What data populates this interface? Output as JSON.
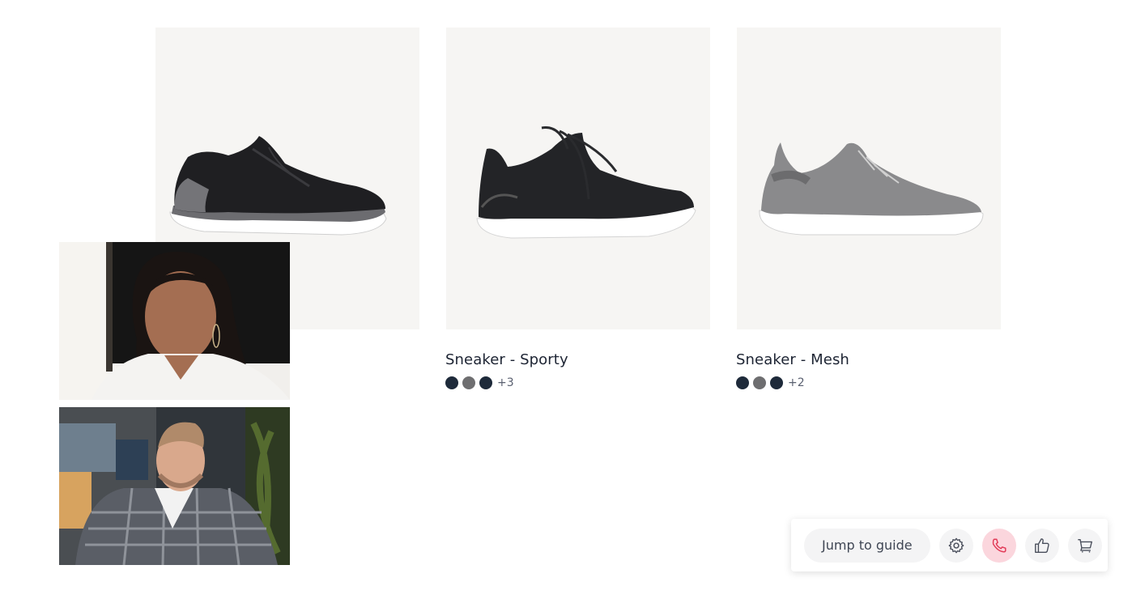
{
  "products": [
    {
      "name": "",
      "shoe_color": "#1f1f22",
      "swatch_colors": []
    },
    {
      "name": "Sneaker - Sporty",
      "shoe_color": "#232427",
      "swatch_colors": [
        "#1e2a3a",
        "#6e6e70",
        "#1e2a3a"
      ],
      "more": "+3"
    },
    {
      "name": "Sneaker - Mesh",
      "shoe_color": "#8a8a8c",
      "swatch_colors": [
        "#1e2a3a",
        "#6e6e70",
        "#1e2a3a"
      ],
      "more": "+2"
    }
  ],
  "controls": {
    "jump_label": "Jump to guide",
    "settings_icon": "gear-icon",
    "end_call_icon": "phone-icon",
    "like_icon": "thumbs-up-icon",
    "cart_icon": "cart-icon"
  },
  "colors": {
    "card_bg": "#f6f5f3",
    "danger_bg": "#fbd6dd",
    "danger_icon": "#e23a57",
    "text": "#1d2433"
  }
}
